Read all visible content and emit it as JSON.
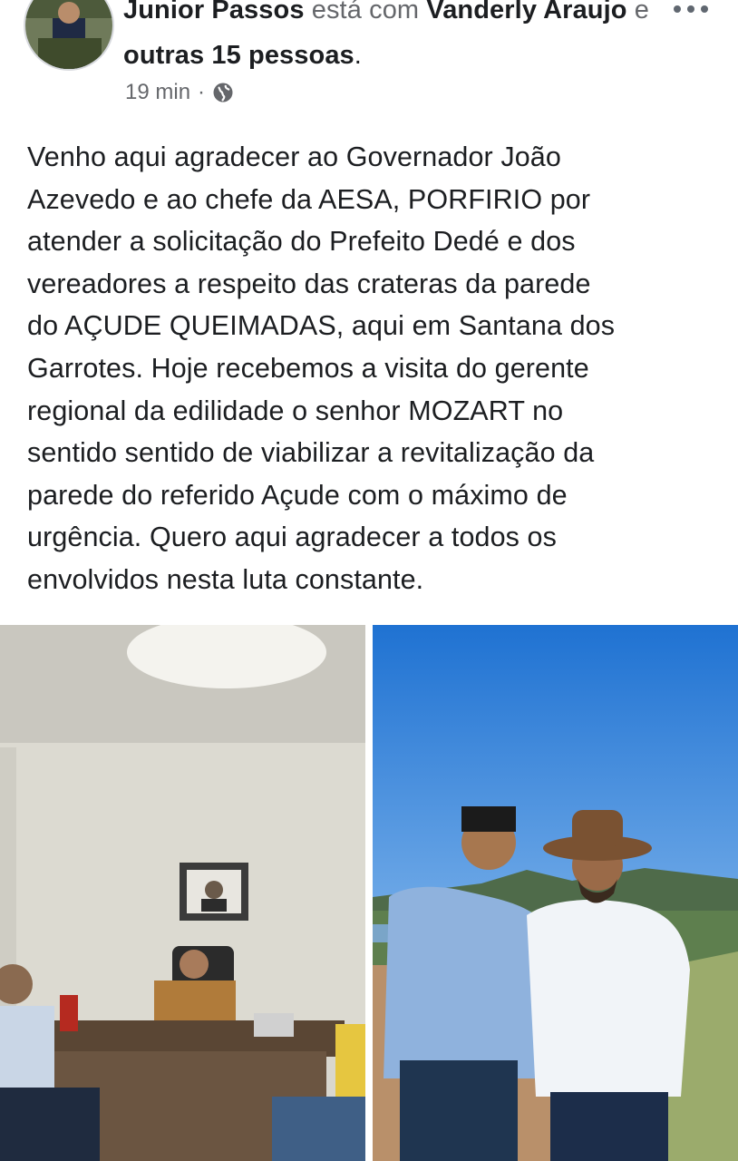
{
  "post": {
    "author": "Junior Passos",
    "connector": "está com",
    "tagged": "Vanderly Araujo",
    "and": "e",
    "others": "outras 15 pessoas",
    "period": ".",
    "time": "19 min",
    "separator": "·",
    "audience_icon": "globe-icon",
    "more_icon": "more-options-icon",
    "text": "Venho aqui agradecer ao Governador João\nAzevedo e ao chefe da AESA, PORFIRIO por\natender a solicitação do Prefeito Dedé e dos\nvereadores a respeito das crateras da parede\ndo AÇUDE QUEIMADAS, aqui em Santana dos\nGarrotes. Hoje recebemos a visita do gerente\nregional da edilidade o senhor MOZART no\nsentido sentido de viabilizar a revitalização da\nparede do referido Açude com o máximo de\nurgência. Quero aqui agradecer a todos os\nenvolvidos nesta luta constante."
  },
  "photos": [
    {
      "id": "photo-office"
    },
    {
      "id": "photo-outdoor"
    }
  ],
  "colors": {
    "text": "#1c1e21",
    "muted": "#65676b",
    "sky": "#2f7fd6"
  }
}
